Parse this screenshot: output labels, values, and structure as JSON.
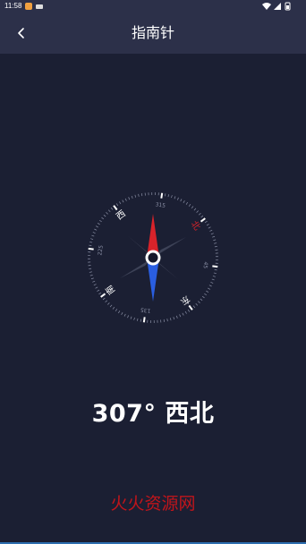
{
  "status_bar": {
    "time": "11:58",
    "icons": [
      "notification-app-icon",
      "video-icon",
      "wifi-icon",
      "signal-icon",
      "battery-icon"
    ]
  },
  "header": {
    "title": "指南针",
    "back_icon": "chevron-left-icon"
  },
  "compass": {
    "heading_degrees": 307,
    "cardinals": {
      "north": "北",
      "east": "东",
      "south": "南",
      "west": "西"
    },
    "degree_labels": {
      "d45": "45",
      "d135": "135",
      "d225": "225",
      "d315": "315"
    },
    "colors": {
      "north_needle": "#d8232a",
      "south_needle": "#2a5ee0",
      "north_label": "#d8232a"
    }
  },
  "readout": {
    "text": "307° 西北"
  },
  "watermark": {
    "text": "火火资源网",
    "color": "#c0151b"
  }
}
